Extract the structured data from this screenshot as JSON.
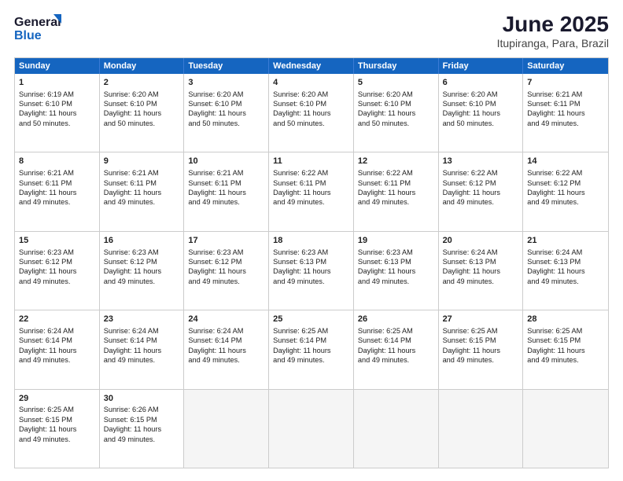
{
  "header": {
    "logo_line1": "General",
    "logo_line2": "Blue",
    "title": "June 2025",
    "location": "Itupiranga, Para, Brazil"
  },
  "days_of_week": [
    "Sunday",
    "Monday",
    "Tuesday",
    "Wednesday",
    "Thursday",
    "Friday",
    "Saturday"
  ],
  "weeks": [
    [
      {
        "day": "1",
        "text": "Sunrise: 6:19 AM\nSunset: 6:10 PM\nDaylight: 11 hours\nand 50 minutes."
      },
      {
        "day": "2",
        "text": "Sunrise: 6:20 AM\nSunset: 6:10 PM\nDaylight: 11 hours\nand 50 minutes."
      },
      {
        "day": "3",
        "text": "Sunrise: 6:20 AM\nSunset: 6:10 PM\nDaylight: 11 hours\nand 50 minutes."
      },
      {
        "day": "4",
        "text": "Sunrise: 6:20 AM\nSunset: 6:10 PM\nDaylight: 11 hours\nand 50 minutes."
      },
      {
        "day": "5",
        "text": "Sunrise: 6:20 AM\nSunset: 6:10 PM\nDaylight: 11 hours\nand 50 minutes."
      },
      {
        "day": "6",
        "text": "Sunrise: 6:20 AM\nSunset: 6:10 PM\nDaylight: 11 hours\nand 50 minutes."
      },
      {
        "day": "7",
        "text": "Sunrise: 6:21 AM\nSunset: 6:11 PM\nDaylight: 11 hours\nand 49 minutes."
      }
    ],
    [
      {
        "day": "8",
        "text": "Sunrise: 6:21 AM\nSunset: 6:11 PM\nDaylight: 11 hours\nand 49 minutes."
      },
      {
        "day": "9",
        "text": "Sunrise: 6:21 AM\nSunset: 6:11 PM\nDaylight: 11 hours\nand 49 minutes."
      },
      {
        "day": "10",
        "text": "Sunrise: 6:21 AM\nSunset: 6:11 PM\nDaylight: 11 hours\nand 49 minutes."
      },
      {
        "day": "11",
        "text": "Sunrise: 6:22 AM\nSunset: 6:11 PM\nDaylight: 11 hours\nand 49 minutes."
      },
      {
        "day": "12",
        "text": "Sunrise: 6:22 AM\nSunset: 6:11 PM\nDaylight: 11 hours\nand 49 minutes."
      },
      {
        "day": "13",
        "text": "Sunrise: 6:22 AM\nSunset: 6:12 PM\nDaylight: 11 hours\nand 49 minutes."
      },
      {
        "day": "14",
        "text": "Sunrise: 6:22 AM\nSunset: 6:12 PM\nDaylight: 11 hours\nand 49 minutes."
      }
    ],
    [
      {
        "day": "15",
        "text": "Sunrise: 6:23 AM\nSunset: 6:12 PM\nDaylight: 11 hours\nand 49 minutes."
      },
      {
        "day": "16",
        "text": "Sunrise: 6:23 AM\nSunset: 6:12 PM\nDaylight: 11 hours\nand 49 minutes."
      },
      {
        "day": "17",
        "text": "Sunrise: 6:23 AM\nSunset: 6:12 PM\nDaylight: 11 hours\nand 49 minutes."
      },
      {
        "day": "18",
        "text": "Sunrise: 6:23 AM\nSunset: 6:13 PM\nDaylight: 11 hours\nand 49 minutes."
      },
      {
        "day": "19",
        "text": "Sunrise: 6:23 AM\nSunset: 6:13 PM\nDaylight: 11 hours\nand 49 minutes."
      },
      {
        "day": "20",
        "text": "Sunrise: 6:24 AM\nSunset: 6:13 PM\nDaylight: 11 hours\nand 49 minutes."
      },
      {
        "day": "21",
        "text": "Sunrise: 6:24 AM\nSunset: 6:13 PM\nDaylight: 11 hours\nand 49 minutes."
      }
    ],
    [
      {
        "day": "22",
        "text": "Sunrise: 6:24 AM\nSunset: 6:14 PM\nDaylight: 11 hours\nand 49 minutes."
      },
      {
        "day": "23",
        "text": "Sunrise: 6:24 AM\nSunset: 6:14 PM\nDaylight: 11 hours\nand 49 minutes."
      },
      {
        "day": "24",
        "text": "Sunrise: 6:24 AM\nSunset: 6:14 PM\nDaylight: 11 hours\nand 49 minutes."
      },
      {
        "day": "25",
        "text": "Sunrise: 6:25 AM\nSunset: 6:14 PM\nDaylight: 11 hours\nand 49 minutes."
      },
      {
        "day": "26",
        "text": "Sunrise: 6:25 AM\nSunset: 6:14 PM\nDaylight: 11 hours\nand 49 minutes."
      },
      {
        "day": "27",
        "text": "Sunrise: 6:25 AM\nSunset: 6:15 PM\nDaylight: 11 hours\nand 49 minutes."
      },
      {
        "day": "28",
        "text": "Sunrise: 6:25 AM\nSunset: 6:15 PM\nDaylight: 11 hours\nand 49 minutes."
      }
    ],
    [
      {
        "day": "29",
        "text": "Sunrise: 6:25 AM\nSunset: 6:15 PM\nDaylight: 11 hours\nand 49 minutes."
      },
      {
        "day": "30",
        "text": "Sunrise: 6:26 AM\nSunset: 6:15 PM\nDaylight: 11 hours\nand 49 minutes."
      },
      {
        "day": "",
        "text": "",
        "empty": true
      },
      {
        "day": "",
        "text": "",
        "empty": true
      },
      {
        "day": "",
        "text": "",
        "empty": true
      },
      {
        "day": "",
        "text": "",
        "empty": true
      },
      {
        "day": "",
        "text": "",
        "empty": true
      }
    ]
  ]
}
